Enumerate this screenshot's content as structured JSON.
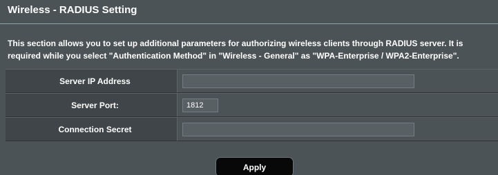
{
  "page": {
    "title": "Wireless - RADIUS Setting",
    "description": "This section allows you to set up additional parameters for authorizing wireless clients through RADIUS server. It is required while you select \"Authentication Method\" in \"Wireless - General\" as \"WPA-Enterprise / WPA2-Enterprise\"."
  },
  "form": {
    "fields": [
      {
        "label": "Server IP Address",
        "value": "",
        "placeholder": ""
      },
      {
        "label": "Server Port:",
        "value": "1812",
        "placeholder": ""
      },
      {
        "label": "Connection Secret",
        "value": "",
        "placeholder": ""
      }
    ]
  },
  "actions": {
    "apply_label": "Apply"
  },
  "colors": {
    "background": "#4c5356",
    "label_background": "#3f4548",
    "input_background": "#596064",
    "button_background": "#080808",
    "text": "#ffffff"
  }
}
